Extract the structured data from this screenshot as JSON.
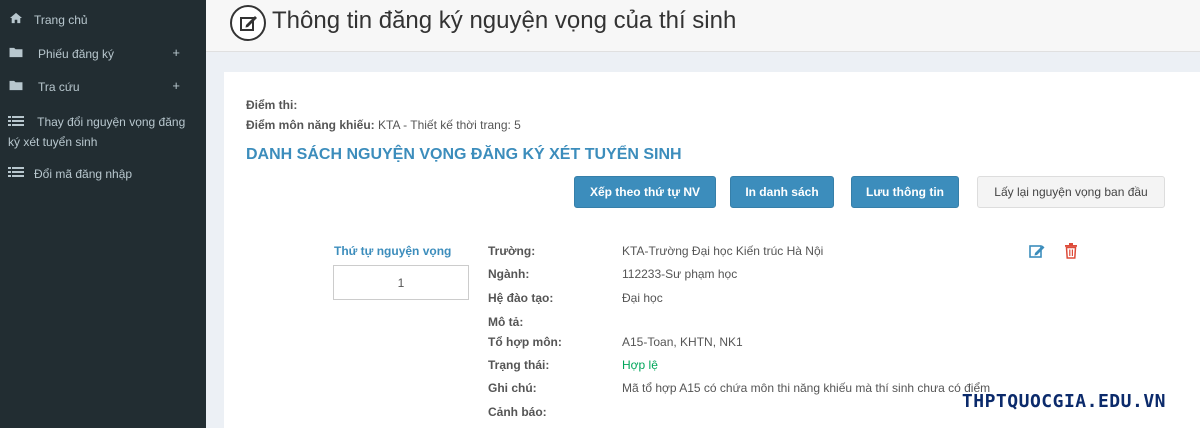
{
  "sidebar": {
    "items": [
      {
        "label": "Trang chủ",
        "icon": "home-icon"
      },
      {
        "label": "Phiếu đăng ký",
        "icon": "folder-icon",
        "expand": "+"
      },
      {
        "label": "Tra cứu",
        "icon": "folder-icon",
        "expand": "+"
      },
      {
        "label": "Thay đổi nguyện vọng đăng ký xét tuyển sinh",
        "icon": "list-icon"
      },
      {
        "label": "Đổi mã đăng nhập",
        "icon": "list-icon"
      }
    ]
  },
  "header": {
    "title": "Thông tin đăng ký nguyện vọng của thí sinh",
    "icon": "edit-circle-icon"
  },
  "info": {
    "exam_score_label": "Điểm thi:",
    "aptitude_label": "Điểm môn năng khiếu:",
    "aptitude_value": "KTA - Thiết kế thời trang: 5"
  },
  "section_title": "DANH SÁCH NGUYỆN VỌNG ĐĂNG KÝ XÉT TUYỂN SINH",
  "buttons": {
    "sort": "Xếp theo thứ tự NV",
    "print": "In danh sách",
    "save": "Lưu thông tin",
    "reset": "Lấy lại nguyện vọng ban đầu"
  },
  "wish": {
    "order_label": "Thứ tự nguyện vọng",
    "order_value": "1",
    "fields": [
      {
        "label": "Trường:",
        "value": "KTA-Trường Đại học Kiến trúc Hà Nội"
      },
      {
        "label": "Ngành:",
        "value": "112233-Sư phạm học"
      },
      {
        "label": "Hệ đào tạo:",
        "value": "Đại học"
      },
      {
        "label": "Mô tả:",
        "value": ""
      },
      {
        "label": "Tổ hợp môn:",
        "value": "A15-Toan, KHTN, NK1"
      },
      {
        "label": "Trạng thái:",
        "value": "Hợp lệ"
      },
      {
        "label": "Ghi chú:",
        "value": "Mã tổ hợp A15 có chứa môn thi năng khiếu mà thí sinh chưa có điểm"
      },
      {
        "label": "Cảnh báo:",
        "value": ""
      }
    ]
  },
  "colors": {
    "sidebar": "#222d32",
    "accent": "#3c8dbc",
    "delete": "#dd4b39",
    "status_ok": "#00a65a"
  },
  "watermark": "THPTQUOCGIA.EDU.VN"
}
